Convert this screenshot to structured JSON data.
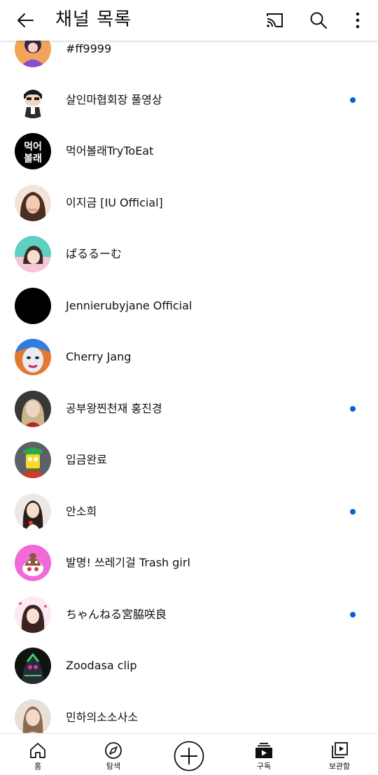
{
  "header": {
    "title": "채널 목록",
    "back_icon": "arrow-left-icon",
    "cast_icon": "cast-icon",
    "search_icon": "search-icon",
    "more_icon": "more-vertical-icon"
  },
  "channels": [
    {
      "name": "#ff9999",
      "new": false
    },
    {
      "name": "살인마협회장 풀영상",
      "new": true
    },
    {
      "name": "먹어볼래TryToEat",
      "new": false
    },
    {
      "name": "이지금 [IU Official]",
      "new": false
    },
    {
      "name": "ぱるるーむ",
      "new": false
    },
    {
      "name": "Jennierubyjane Official",
      "new": false
    },
    {
      "name": "Cherry Jang",
      "new": false
    },
    {
      "name": "공부왕찐천재 홍진경",
      "new": true
    },
    {
      "name": "입금완료",
      "new": false
    },
    {
      "name": "안소희",
      "new": true
    },
    {
      "name": "발명! 쓰레기걸 Trash girl",
      "new": false
    },
    {
      "name": "ちゃんねる宮脇咲良",
      "new": true
    },
    {
      "name": "Zoodasa clip",
      "new": false
    },
    {
      "name": "민하의소소사소",
      "new": false
    }
  ],
  "avatar_logo_text": [
    "먹어",
    "볼래"
  ],
  "bottom_nav": {
    "home": "홈",
    "explore": "탐색",
    "subscriptions": "구독",
    "library": "보관함"
  },
  "colors": {
    "new_dot": "#065fd4",
    "text": "#0f0f0f",
    "divider": "#e5e5e5"
  }
}
